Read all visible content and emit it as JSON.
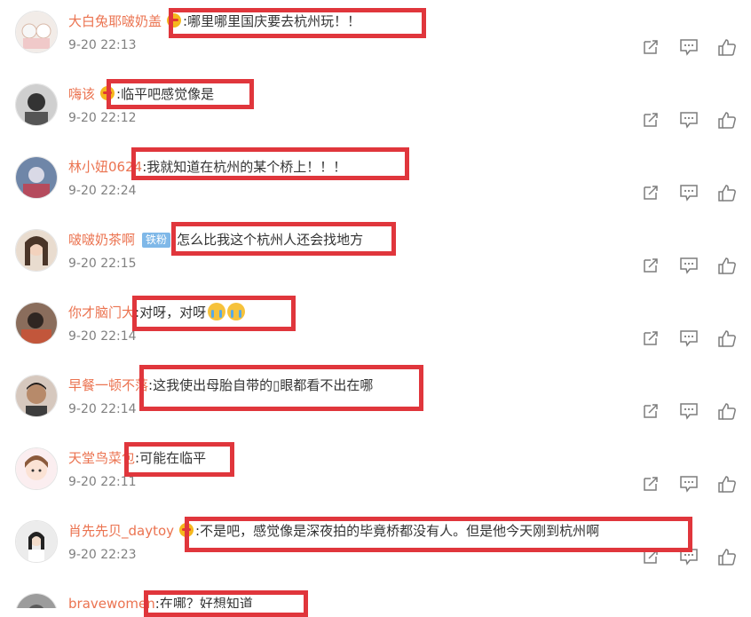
{
  "comments": [
    {
      "username": "大白兔耶啵奶盖",
      "badge": "emoji",
      "text": ":哪里哪里国庆要去杭州玩！！",
      "time": "9-20 22:13"
    },
    {
      "username": "嗨该",
      "badge": "emoji",
      "text": ":临平吧感觉像是",
      "time": "9-20 22:12"
    },
    {
      "username": "林小妞0624",
      "badge": "",
      "text": ":我就知道在杭州的某个桥上！！！",
      "time": "9-20 22:24"
    },
    {
      "username": "啵啵奶茶啊",
      "badge": "fan",
      "fan_label": "铁粉",
      "text": ":怎么比我这个杭州人还会找地方",
      "time": "9-20 22:15"
    },
    {
      "username": "你才脑门大",
      "badge": "",
      "text": ":对呀，对呀",
      "time": "9-20 22:14",
      "trail_emojis": 2
    },
    {
      "username": "早餐一顿不落",
      "badge": "",
      "text": ":这我使出母胎自带的▯眼都看不出在哪",
      "time": "9-20 22:14"
    },
    {
      "username": "天堂鸟菜包",
      "badge": "",
      "text": ":可能在临平",
      "time": "9-20 22:11"
    },
    {
      "username": "肖先先贝_daytoy",
      "badge": "emoji",
      "text": ":不是吧，感觉像是深夜拍的毕竟桥都没有人。但是他今天刚到杭州啊",
      "time": "9-20 22:23"
    },
    {
      "username": "bravewomen",
      "badge": "",
      "text": ":在哪？好想知道",
      "time": ""
    }
  ],
  "icons": {
    "share": "share-icon",
    "reply": "comment-icon",
    "like": "thumbs-up-icon"
  },
  "colors": {
    "username": "#eb7350",
    "highlight": "#e0363c",
    "time": "#808080",
    "icon": "#7d7d7d"
  }
}
